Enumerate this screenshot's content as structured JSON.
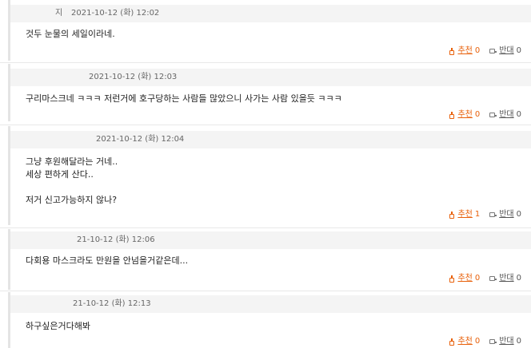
{
  "comments": [
    {
      "author_fragment": "지",
      "timestamp": "2021-10-12 (화) 12:02",
      "text": "것두 눈물의 세일이라네.",
      "up_label": "추천",
      "up_count": "0",
      "down_label": "반대",
      "down_count": "0"
    },
    {
      "timestamp": "2021-10-12 (화) 12:03",
      "text": "구리마스크네 ㅋㅋㅋ 저런거에 호구당하는 사람들 많았으니 사가는 사람 있을듯 ㅋㅋㅋ",
      "up_label": "추천",
      "up_count": "0",
      "down_label": "반대",
      "down_count": "0"
    },
    {
      "timestamp": "2021-10-12 (화) 12:04",
      "text": "그냥 후원해달라는 거네..\n세상 편하게 산다..\n\n저거 신고가능하지 않나?",
      "up_label": "추천",
      "up_count": "1",
      "down_label": "반대",
      "down_count": "0"
    },
    {
      "timestamp": "21-10-12 (화) 12:06",
      "text": "다회용 마스크라도 만원을 안넘을거같은데...",
      "up_label": "추천",
      "up_count": "0",
      "down_label": "반대",
      "down_count": "0"
    },
    {
      "timestamp": "21-10-12 (화) 12:13",
      "text": "하구싶은거다해봐",
      "up_label": "추천",
      "up_count": "0",
      "down_label": "반대",
      "down_count": "0"
    }
  ]
}
